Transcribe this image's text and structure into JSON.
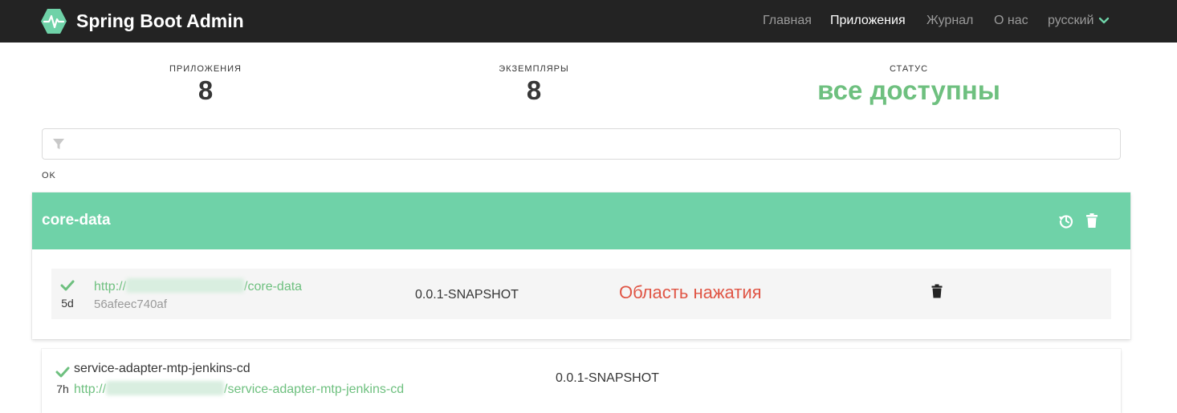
{
  "navbar": {
    "brand": "Spring Boot Admin",
    "items": [
      "Главная",
      "Приложения",
      "Журнал",
      "О нас"
    ],
    "active_index": 1,
    "language": "русский"
  },
  "stats": {
    "applications": {
      "label": "ПРИЛОЖЕНИЯ",
      "value": "8"
    },
    "instances": {
      "label": "ЭКЗЕМПЛЯРЫ",
      "value": "8"
    },
    "status": {
      "label": "СТАТУС",
      "value": "все доступны"
    }
  },
  "filter": {
    "value": "",
    "placeholder": ""
  },
  "group_label": "OK",
  "application": {
    "name": "core-data",
    "instance": {
      "age": "5d",
      "url_prefix": "http://",
      "url_suffix": "/core-data",
      "id": "56afeec740af",
      "version": "0.0.1-SNAPSHOT",
      "click_area": "Область нажатия"
    }
  },
  "application2": {
    "age": "7h",
    "name": "service-adapter-mtp-jenkins-cd",
    "url_prefix": "http://",
    "url_suffix": "/service-adapter-mtp-jenkins-cd",
    "version": "0.0.1-SNAPSHOT"
  },
  "colors": {
    "navbar": "#232323",
    "accent": "#6ec07f",
    "card_header": "#6fd2a8",
    "click_area": "#e05545"
  }
}
